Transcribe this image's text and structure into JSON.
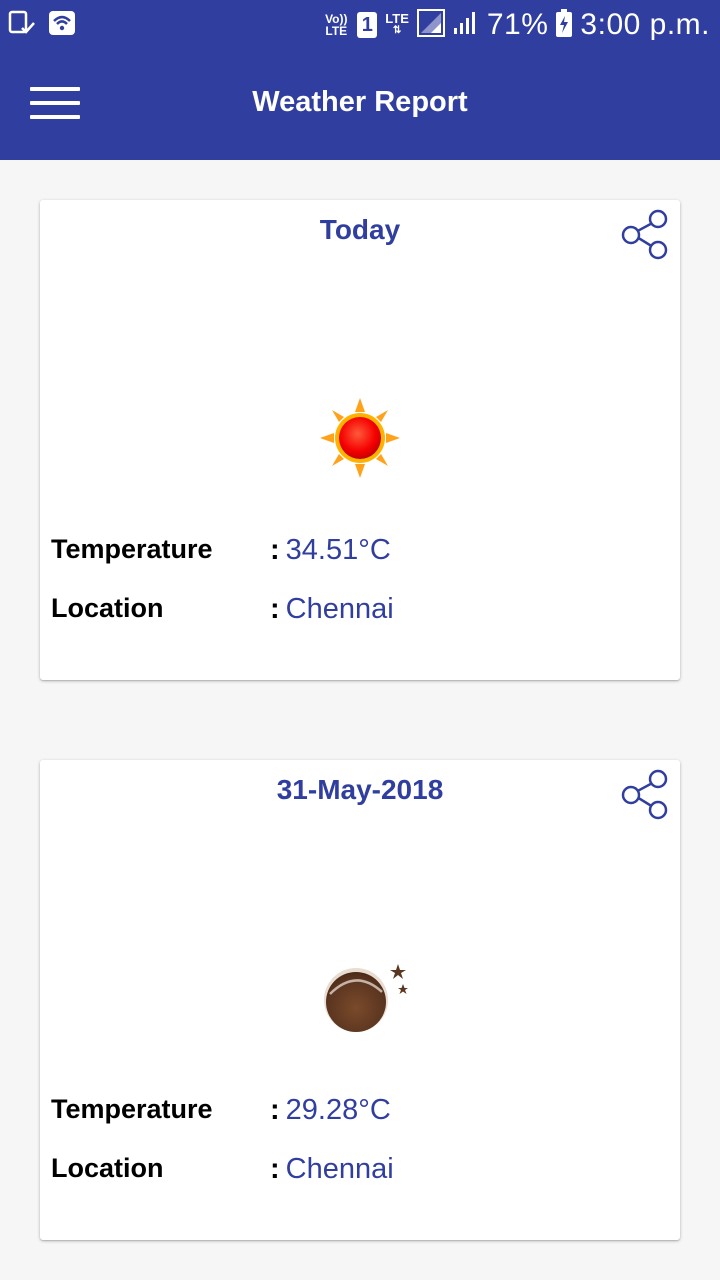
{
  "status_bar": {
    "volte": "Vo))\nLTE",
    "sim_slot": "1",
    "lte": "LTE",
    "battery_percent": "71%",
    "time": "3:00 p.m."
  },
  "app_bar": {
    "title": "Weather Report",
    "menu_icon": "hamburger-menu-icon",
    "color": "#303f9f"
  },
  "cards": [
    {
      "title": "Today",
      "icon": "sun-icon",
      "temperature_label": "Temperature",
      "temperature_value": "34.51°C",
      "location_label": "Location",
      "location_value": "Chennai"
    },
    {
      "title": "31-May-2018",
      "icon": "moon-night-icon",
      "temperature_label": "Temperature",
      "temperature_value": "29.28°C",
      "location_label": "Location",
      "location_value": "Chennai"
    }
  ]
}
